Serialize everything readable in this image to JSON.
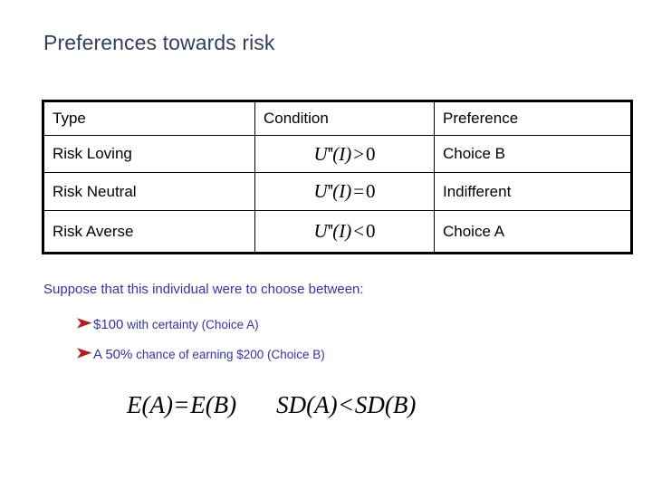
{
  "slide": {
    "title": "Preferences towards risk",
    "title_color": "#2f4259",
    "body_color": "#3333a5",
    "bullet_color": "#b41c1c",
    "background": "#ffffff"
  },
  "table": {
    "headers": [
      "Type",
      "Condition",
      "Preference"
    ],
    "rows": [
      {
        "type": "Risk Loving",
        "condition": {
          "func": "U",
          "prime": "''",
          "arg": "(I)",
          "operator": ">",
          "value": "0",
          "text": "U''(I) > 0"
        },
        "preference": "Choice B"
      },
      {
        "type": "Risk Neutral",
        "condition": {
          "func": "U",
          "prime": "''",
          "arg": "(I)",
          "operator": "=",
          "value": "0",
          "text": "U''(I) = 0"
        },
        "preference": "Indifferent"
      },
      {
        "type": "Risk Averse",
        "condition": {
          "func": "U",
          "prime": "''",
          "arg": "(I)",
          "operator": "<",
          "value": "0",
          "text": "U''(I) < 0"
        },
        "preference": "Choice A"
      }
    ]
  },
  "body": {
    "intro": "Suppose that this individual were to choose between:",
    "bullets": [
      {
        "lead": "$100",
        "rest": " with certainty (Choice A)",
        "marker": "arrowhead-bullet"
      },
      {
        "lead": "A 50%",
        "rest": " chance of earning $200 (Choice B)",
        "marker": "arrowhead-bullet"
      }
    ]
  },
  "equations": {
    "left": {
      "lhs": "E(A)",
      "operator": "=",
      "rhs": "E(B)",
      "text": "E(A) = E(B)"
    },
    "right": {
      "lhs": "SD(A)",
      "operator": "<",
      "rhs": "SD(B)",
      "text": "SD(A) < SD(B)"
    }
  }
}
